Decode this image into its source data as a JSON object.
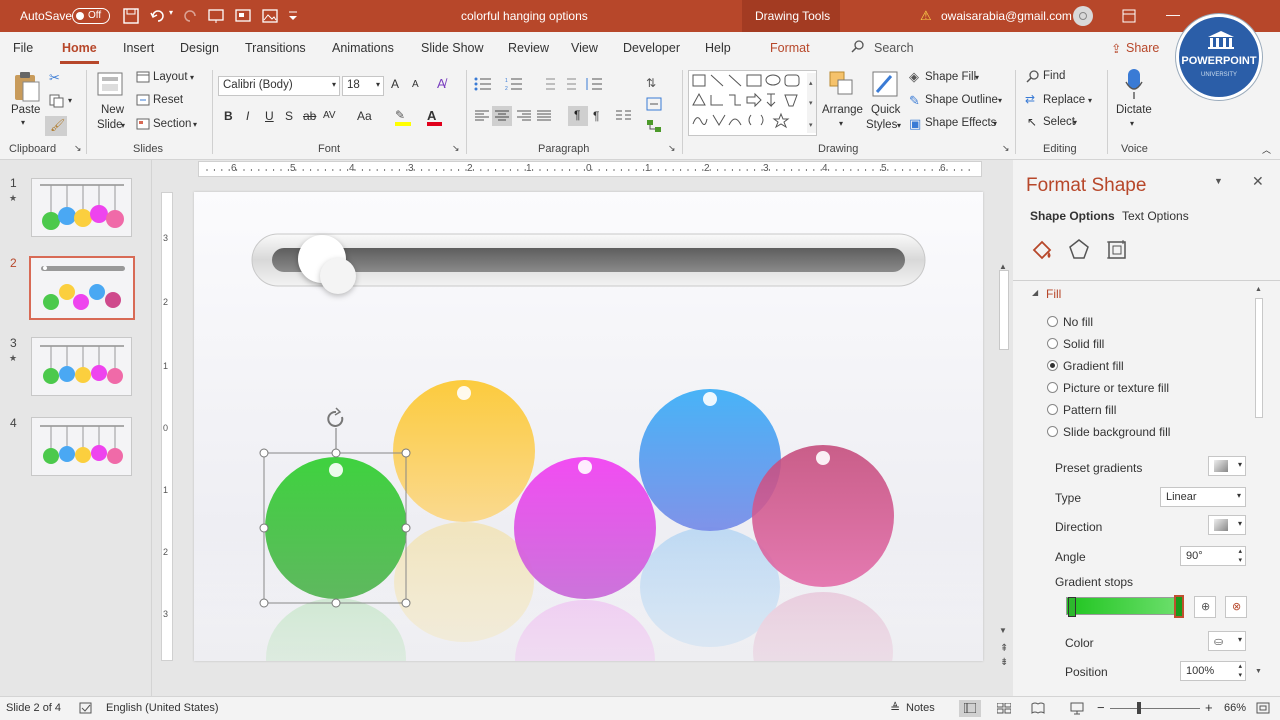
{
  "titlebar": {
    "autosave_label": "AutoSave",
    "autosave_state": "Off",
    "doc_title": "colorful hanging options",
    "context_tab": "Drawing Tools",
    "account_email": "owaisarabia@gmail.com"
  },
  "tabs": [
    "File",
    "Home",
    "Insert",
    "Design",
    "Transitions",
    "Animations",
    "Slide Show",
    "Review",
    "View",
    "Developer",
    "Help",
    "Format"
  ],
  "search_label": "Search",
  "share_label": "Share",
  "logo": {
    "line1": "POWERPOINT",
    "line2": "UNIVERSITY"
  },
  "ribbon": {
    "clipboard": {
      "paste": "Paste",
      "group": "Clipboard"
    },
    "slides": {
      "new_slide_line1": "New",
      "new_slide_line2": "Slide",
      "layout": "Layout",
      "reset": "Reset",
      "section": "Section",
      "group": "Slides"
    },
    "font": {
      "name": "Calibri (Body)",
      "size": "18",
      "group": "Font",
      "bold": "B",
      "italic": "I",
      "underline": "U",
      "strike": "S",
      "grow": "A",
      "shrink": "A",
      "case": "Aa"
    },
    "paragraph": {
      "group": "Paragraph"
    },
    "drawing": {
      "arrange": "Arrange",
      "quick_styles_line1": "Quick",
      "quick_styles_line2": "Styles",
      "shape_fill": "Shape Fill",
      "shape_outline": "Shape Outline",
      "shape_effects": "Shape Effects",
      "group": "Drawing"
    },
    "editing": {
      "find": "Find",
      "replace": "Replace",
      "select": "Select",
      "group": "Editing"
    },
    "voice": {
      "dictate": "Dictate",
      "group": "Voice"
    }
  },
  "ruler_labels": [
    "6",
    "5",
    "4",
    "3",
    "2",
    "1",
    "0",
    "1",
    "2",
    "3",
    "4",
    "5",
    "6"
  ],
  "vruler_labels": [
    "3",
    "2",
    "1",
    "0",
    "1",
    "2",
    "3"
  ],
  "thumbnails": [
    {
      "num": "1",
      "star": "★"
    },
    {
      "num": "2",
      "star": ""
    },
    {
      "num": "3",
      "star": "★"
    },
    {
      "num": "4",
      "star": ""
    }
  ],
  "format_pane": {
    "title": "Format Shape",
    "tab_shape": "Shape Options",
    "tab_text": "Text Options",
    "section": "Fill",
    "fill_options": [
      "No fill",
      "Solid fill",
      "Gradient fill",
      "Picture or texture fill",
      "Pattern fill",
      "Slide background fill"
    ],
    "selected_fill": "Gradient fill",
    "preset_gradients": "Preset gradients",
    "type_label": "Type",
    "type_value": "Linear",
    "direction_label": "Direction",
    "angle_label": "Angle",
    "angle_value": "90°",
    "gradient_stops_label": "Gradient stops",
    "color_label": "Color",
    "position_label": "Position",
    "position_value": "100%"
  },
  "colors": {
    "accent": "#b7472a",
    "green": "#4cc94c",
    "yellow": "#fbcf3e",
    "magenta": "#ee44ee",
    "blue": "#4aa8f3",
    "rose": "#cf4a8c"
  },
  "status": {
    "slide_info": "Slide 2 of 4",
    "language": "English (United States)",
    "notes": "Notes",
    "zoom": "66%"
  }
}
